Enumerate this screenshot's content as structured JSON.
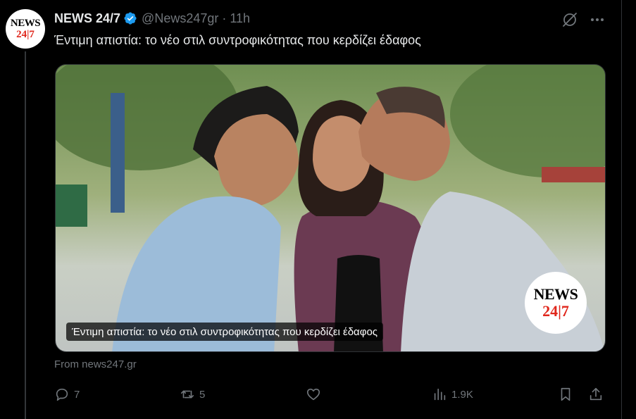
{
  "author": {
    "name": "NEWS 24/7",
    "handle": "@News247gr",
    "time": "11h",
    "avatar_line1": "NEWS",
    "avatar_line2": "24|7"
  },
  "tweet": {
    "text": "Έντιμη απιστία: το νέο στιλ συντροφικότητας που κερδίζει έδαφος"
  },
  "media": {
    "caption": "Έντιμη απιστία: το νέο στιλ συντροφικότητας που κερδίζει έδαφος",
    "logo_line1": "NEWS",
    "logo_line2": "24|7"
  },
  "source": "From news247.gr",
  "actions": {
    "replies": "7",
    "reposts": "5",
    "likes": "",
    "views": "1.9K"
  },
  "colors": {
    "background": "#000000",
    "text": "#e7e9ea",
    "muted": "#71767b",
    "verified": "#1d9bf0",
    "brand_red": "#e0261b"
  },
  "icons": [
    "verified-icon",
    "grok-icon",
    "more-icon",
    "reply-icon",
    "repost-icon",
    "like-icon",
    "views-icon",
    "bookmark-icon",
    "share-icon"
  ]
}
